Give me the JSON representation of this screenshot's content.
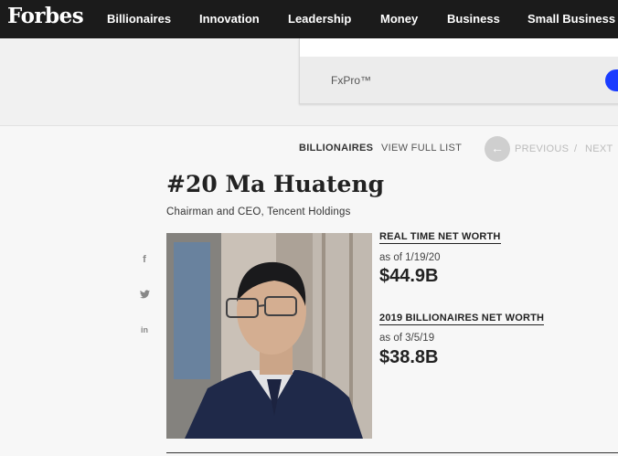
{
  "nav": {
    "logo": "Forbes",
    "items": [
      "Billionaires",
      "Innovation",
      "Leadership",
      "Money",
      "Business",
      "Small Business"
    ]
  },
  "ad": {
    "brand": "FxPro™"
  },
  "breadcrumb": {
    "list": "BILLIONAIRES",
    "view_full": "VIEW FULL LIST",
    "previous": "PREVIOUS",
    "separator": "/",
    "next": "NEXT"
  },
  "profile": {
    "title": "#20 Ma Huateng",
    "subtitle": "Chairman and CEO, Tencent Holdings",
    "realtime": {
      "label": "REAL TIME NET WORTH",
      "as_of": "as of 1/19/20",
      "value": "$44.9B"
    },
    "annual": {
      "label": "2019 BILLIONAIRES NET WORTH",
      "as_of": "as of 3/5/19",
      "value": "$38.8B"
    }
  },
  "share": {
    "facebook": "f",
    "linkedin": "in"
  },
  "colors": {
    "nav_bg": "#1b1b1b",
    "ad_cta": "#1a3cff",
    "page_bg": "#f7f7f7"
  }
}
